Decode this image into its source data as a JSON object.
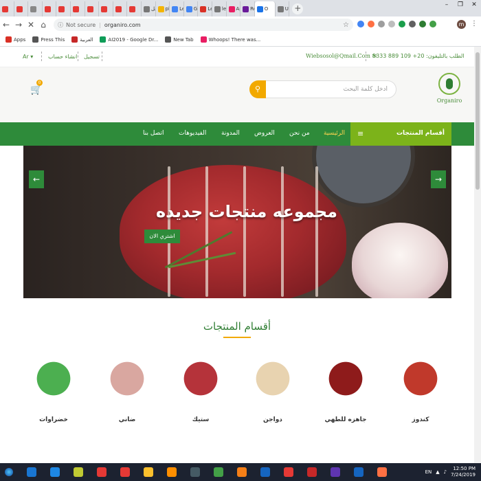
{
  "browser": {
    "tabs": [
      {
        "title": "",
        "color": "#e53935"
      },
      {
        "title": "",
        "color": "#e53935"
      },
      {
        "title": "",
        "color": "#888888"
      },
      {
        "title": "",
        "color": "#e53935"
      },
      {
        "title": "",
        "color": "#e53935"
      },
      {
        "title": "",
        "color": "#e53935"
      },
      {
        "title": "",
        "color": "#e53935"
      },
      {
        "title": "",
        "color": "#e53935"
      },
      {
        "title": "",
        "color": "#e53935"
      },
      {
        "title": "",
        "color": "#e53935"
      },
      {
        "title": "تحل",
        "color": "#777777"
      },
      {
        "title": "php",
        "color": "#f4b400"
      },
      {
        "title": "Lets",
        "color": "#4285f4"
      },
      {
        "title": "Goo",
        "color": "#4285f4"
      },
      {
        "title": "Lets",
        "color": "#d93025"
      },
      {
        "title": "letg",
        "color": "#777777"
      },
      {
        "title": "App",
        "color": "#e91e63"
      },
      {
        "title": "Rent",
        "color": "#6a1b9a"
      },
      {
        "title": "O",
        "color": "#1a73e8",
        "active": true
      },
      {
        "title": "Ubo",
        "color": "#777777"
      }
    ],
    "new_tab": "+",
    "window_controls": [
      "–",
      "❐",
      "✕"
    ],
    "url_prefix": "Not secure",
    "url": "organiro.com",
    "profile_initial": "m",
    "bookmarks": [
      {
        "label": "Apps",
        "color": "#d93025"
      },
      {
        "label": "Press This",
        "color": "#555555"
      },
      {
        "label": "العربية",
        "color": "#c62828"
      },
      {
        "label": "AI2019 - Google Dr...",
        "color": "#0f9d58"
      },
      {
        "label": "New Tab",
        "color": "#555555"
      },
      {
        "label": "Whoops! There was...",
        "color": "#e91e63"
      }
    ]
  },
  "site": {
    "topbar": {
      "lang": "Ar",
      "signup": "انشاء حساب",
      "login": "تسجيل",
      "email": "Wiebsosol@Qmail.Com",
      "phone": "الطلب بالتليفون: 20+ 109 889 5333"
    },
    "logo": {
      "name": "Organiro"
    },
    "search": {
      "placeholder": "ادخل كلمة البحث"
    },
    "cart": {
      "count": "0"
    },
    "nav": {
      "categories_label": "أقسام المنتجات",
      "home": "الرئيسية",
      "about": "من نحن",
      "offers": "العروض",
      "blog": "المدونة",
      "videos": "الفيديوهات",
      "contact": "اتصل بنا"
    },
    "slider": {
      "title": "مجموعه منتجات جديده",
      "cta": "اشتري الان",
      "prev": "←",
      "next": "→"
    },
    "section_title": "أقسام المنتجات",
    "categories": [
      {
        "label": "كندوز",
        "color": "#c0392b"
      },
      {
        "label": "جاهزه للطهي",
        "color": "#8e1b1b"
      },
      {
        "label": "دواجن",
        "color": "#e8d3b0"
      },
      {
        "label": "ستيك",
        "color": "#b5333a"
      },
      {
        "label": "ضاني",
        "color": "#d9a7a0"
      },
      {
        "label": "خضراوات",
        "color": "#4caf50"
      }
    ]
  },
  "taskbar": {
    "apps": [
      "#1976d2",
      "#1e88e5",
      "#c0ca33",
      "#e53935",
      "#e53935",
      "#fbc02d",
      "#ff8f00",
      "#455a64",
      "#43a047",
      "#f57f17",
      "#1565c0",
      "#e53935",
      "#c62828",
      "#5e35b1",
      "#1565c0",
      "#ff7043"
    ],
    "tray_lang": "EN",
    "time": "12:50 PM",
    "date": "7/24/2019"
  }
}
